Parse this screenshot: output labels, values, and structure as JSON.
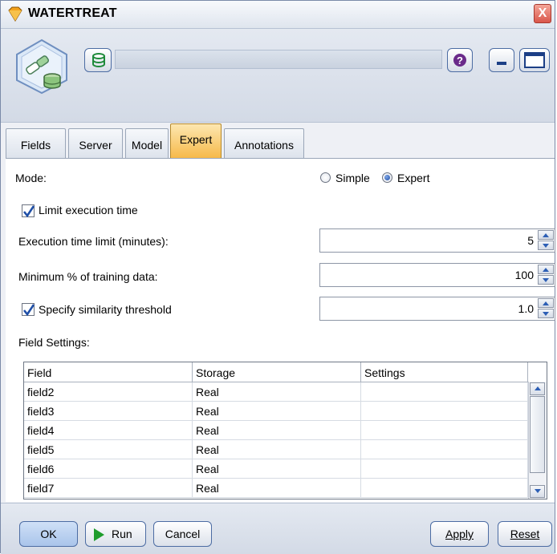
{
  "window": {
    "title": "WATERTREAT",
    "close_glyph": "X"
  },
  "header": {
    "node_icon": "model-node-icon",
    "database_icon": "database-icon",
    "help_icon": "help-icon",
    "minimize_icon": "minimize-icon",
    "maximize_icon": "maximize-icon"
  },
  "tabs": [
    {
      "label": "Fields",
      "active": false
    },
    {
      "label": "Server",
      "active": false
    },
    {
      "label": "Model",
      "active": false
    },
    {
      "label": "Expert",
      "active": true
    },
    {
      "label": "Annotations",
      "active": false
    }
  ],
  "expert": {
    "mode_label": "Mode:",
    "mode_simple": "Simple",
    "mode_expert": "Expert",
    "mode_selected": "Expert",
    "limit_execution_label": "Limit execution time",
    "limit_execution_checked": true,
    "execution_time_label": "Execution time limit (minutes):",
    "execution_time_value": "5",
    "min_training_label": "Minimum % of training data:",
    "min_training_value": "100",
    "similarity_label": "Specify similarity threshold",
    "similarity_checked": true,
    "similarity_value": "1.0",
    "field_settings_label": "Field Settings:"
  },
  "field_table": {
    "columns": [
      "Field",
      "Storage",
      "Settings"
    ],
    "rows": [
      {
        "field": "field2",
        "storage": "Real",
        "settings": ""
      },
      {
        "field": "field3",
        "storage": "Real",
        "settings": ""
      },
      {
        "field": "field4",
        "storage": "Real",
        "settings": ""
      },
      {
        "field": "field5",
        "storage": "Real",
        "settings": ""
      },
      {
        "field": "field6",
        "storage": "Real",
        "settings": ""
      },
      {
        "field": "field7",
        "storage": "Real",
        "settings": ""
      }
    ]
  },
  "footer": {
    "ok_label": "OK",
    "run_label": "Run",
    "cancel_label": "Cancel",
    "apply_label": "Apply",
    "reset_label": "Reset"
  },
  "colors": {
    "active_tab": "#f6b94a",
    "close_button": "#d9564a",
    "accent_blue": "#2d5fb5",
    "run_green": "#1f9d2c"
  }
}
